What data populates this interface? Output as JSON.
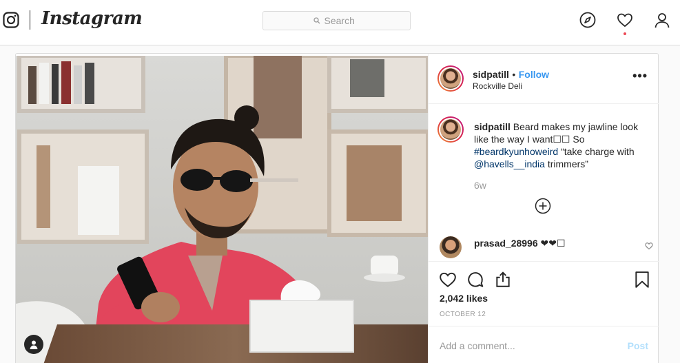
{
  "app": {
    "wordmark": "Instagram"
  },
  "search": {
    "placeholder": "Search"
  },
  "nav_icons": [
    "compass-icon",
    "heart-icon",
    "profile-icon"
  ],
  "colors": {
    "brand_blue": "#3897f0",
    "notification_dot": "#ed4956",
    "border": "#dbdbdb",
    "hashtag": "#003569",
    "shirt": "#e2455c"
  },
  "post": {
    "author": "sidpatill",
    "separator": "•",
    "follow_label": "Follow",
    "location": "Rockville Deli",
    "more_label": "•••",
    "caption": {
      "author": "sidpatill",
      "text_1": "Beard makes my jawline look like the way I want☐☐ So",
      "hashtag": "#beardkyunhoweird",
      "text_2": "“take charge with",
      "mention": "@havells__india",
      "text_3": "trimmers”"
    },
    "time_ago": "6w",
    "comments": [
      {
        "author": "prasad_28996",
        "text": "❤❤☐"
      }
    ],
    "likes": "2,042 likes",
    "date": "OCTOBER 12",
    "add_comment_placeholder": "Add a comment...",
    "post_label": "Post"
  }
}
